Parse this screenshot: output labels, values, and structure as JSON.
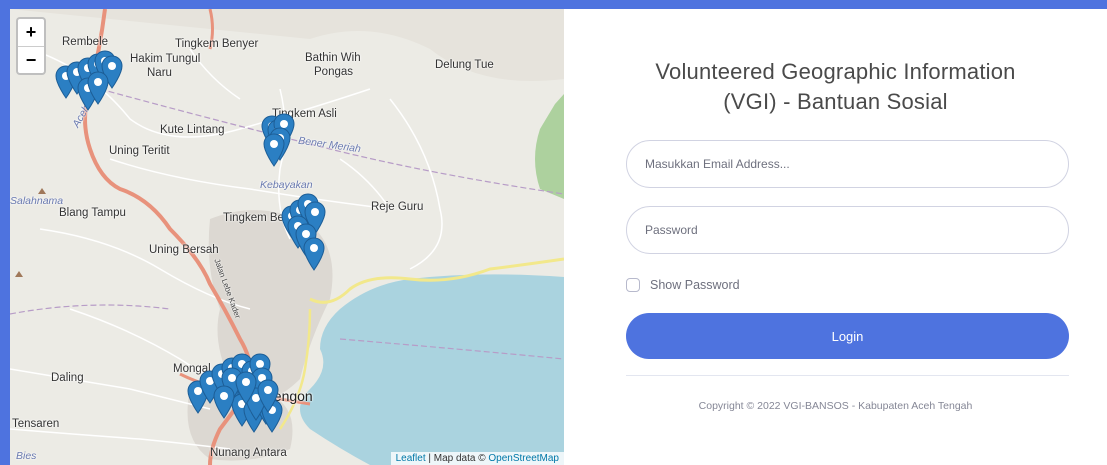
{
  "map": {
    "zoom_in_label": "+",
    "zoom_out_label": "−",
    "places": [
      {
        "name": "Rembele"
      },
      {
        "name": "Tingkem Benyer"
      },
      {
        "name": "Hakim Tungul"
      },
      {
        "name": "Naru"
      },
      {
        "name": "Bathin Wih"
      },
      {
        "name": "Pongas"
      },
      {
        "name": "Delung Tue"
      },
      {
        "name": "Tingkem Asli"
      },
      {
        "name": "Kute Lintang"
      },
      {
        "name": "Uning Teritit"
      },
      {
        "name": "Bener Meriah"
      },
      {
        "name": "Kebayakan"
      },
      {
        "name": "Reje Guru"
      },
      {
        "name": "Tingkem Bersatu"
      },
      {
        "name": "Blang Tampu"
      },
      {
        "name": "Uning Bersah"
      },
      {
        "name": "Mongal"
      },
      {
        "name": "Daling"
      },
      {
        "name": "Takengon"
      },
      {
        "name": "Tensaren"
      },
      {
        "name": "Nunang Antara"
      },
      {
        "name": "Aceh Tengah"
      },
      {
        "name": "Salahnama"
      },
      {
        "name": "Bies"
      },
      {
        "name": "Jalan Lebe Kader"
      }
    ],
    "attribution": {
      "leaflet": "Leaflet",
      "sep": " | Map data © ",
      "osm": "OpenStreetMap"
    },
    "marker_color": "#2b7fc3",
    "marker_count": 40
  },
  "login": {
    "title_line1": "Volunteered Geographic Information",
    "title_line2": "(VGI) - Bantuan Sosial",
    "email_placeholder": "Masukkan Email Address...",
    "password_placeholder": "Password",
    "show_password_label": "Show Password",
    "login_button": "Login",
    "copyright": "Copyright © 2022 VGI-BANSOS - Kabupaten Aceh Tengah"
  },
  "colors": {
    "accent": "#4e73df",
    "lake": "#aad3df",
    "road_major": "#e8927c",
    "road_minor": "#f7fabf"
  }
}
